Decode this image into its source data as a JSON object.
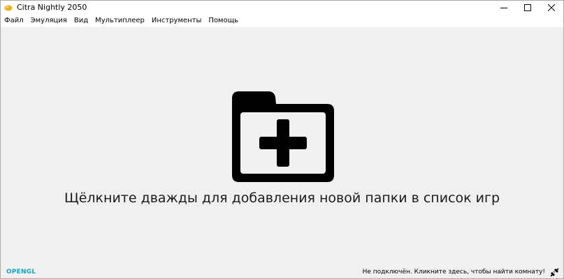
{
  "window": {
    "title": "Citra Nightly 2050",
    "controls": {
      "minimize_icon": "minimize-icon",
      "maximize_icon": "maximize-icon",
      "close_icon": "close-icon"
    }
  },
  "menu": {
    "items": [
      {
        "label": "Файл"
      },
      {
        "label": "Эмуляция"
      },
      {
        "label": "Вид"
      },
      {
        "label": "Мультиплеер"
      },
      {
        "label": "Инструменты"
      },
      {
        "label": "Помощь"
      }
    ]
  },
  "main": {
    "icon": "add-folder-icon",
    "hint": "Щёлкните дважды для добавления новой папки в список игр"
  },
  "statusbar": {
    "renderer": "OPENGL",
    "network_status": "Не подключён. Кликните здесь, чтобы найти комнату!",
    "network_icon": "network-disconnected-icon"
  },
  "colors": {
    "background": "#f0f0f0",
    "renderer_text": "#10a8c0",
    "icon_fill": "#000000"
  }
}
